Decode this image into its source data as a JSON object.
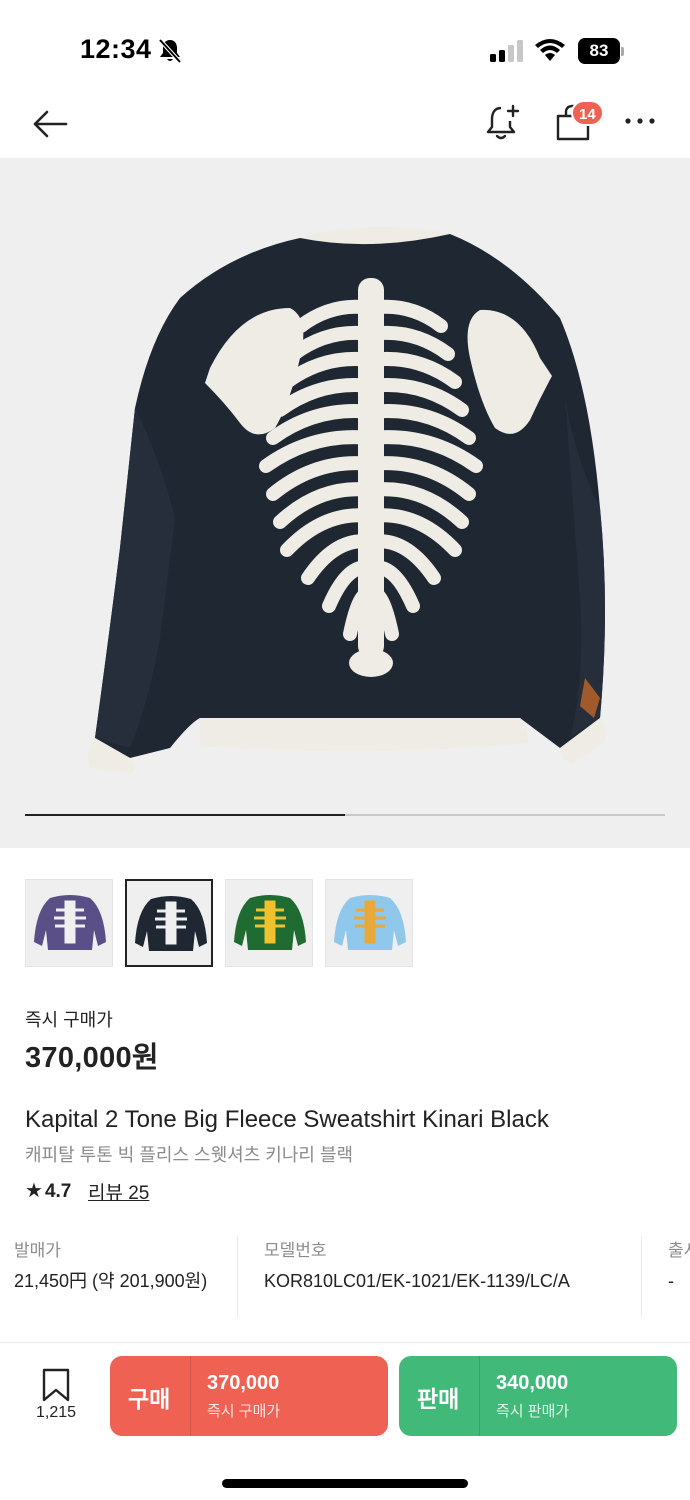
{
  "status_bar": {
    "time": "12:34",
    "battery": "83",
    "icons": [
      "bell-slash-icon",
      "cellular-signal-icon",
      "wifi-icon",
      "battery-icon"
    ]
  },
  "nav": {
    "icons": [
      "back-arrow-icon",
      "bell-plus-icon",
      "shopping-bag-icon",
      "more-icon"
    ],
    "cart_badge": "14"
  },
  "gallery": {
    "progress": 0.5,
    "thumbnail_colors": [
      "#5a4f86",
      "#1f2733",
      "#1f6b32",
      "#8fc8ea"
    ],
    "active_thumbnail": 2
  },
  "price": {
    "label": "즉시 구매가",
    "value": "370,000원"
  },
  "product": {
    "title_en": "Kapital 2 Tone Big Fleece Sweatshirt Kinari Black",
    "title_ko": "캐피탈 투톤 빅 플리스 스웻셔츠 키나리 블랙",
    "rating_star": "★",
    "rating": "4.7",
    "review_link": "리뷰 25"
  },
  "info": {
    "release_price_label": "발매가",
    "release_price_value": "21,450円 (약 201,900원)",
    "model_label": "모델번호",
    "model_value": "KOR810LC01/EK-1021/EK-1139/LC/A",
    "third_label": "출시",
    "third_value": "-"
  },
  "bottom_bar": {
    "wish_count": "1,215",
    "buy_label": "구매",
    "buy_price": "370,000",
    "buy_sub": "즉시 구매가",
    "sell_label": "판매",
    "sell_price": "340,000",
    "sell_sub": "즉시 판매가"
  },
  "colors": {
    "buy": "#ef6253",
    "sell": "#41b979",
    "sweatshirt": "#1f2733",
    "print": "#eeece4"
  }
}
